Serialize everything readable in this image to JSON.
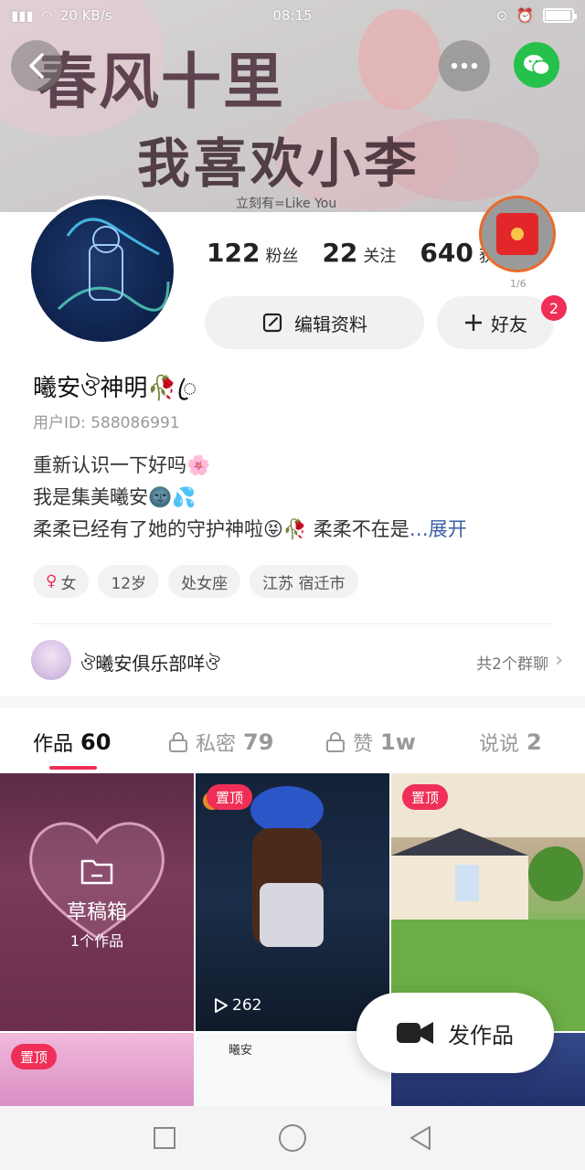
{
  "status_bar": {
    "signal_text": "2G",
    "net_speed": "20 KB/s",
    "time": "08:15"
  },
  "banner": {
    "line1": "春风十里",
    "line2": "我喜欢小李",
    "small_text": "立刻有=Like You"
  },
  "profile": {
    "stats": [
      {
        "num": "122",
        "label": "粉丝"
      },
      {
        "num": "22",
        "label": "关注"
      },
      {
        "num": "640",
        "label": "获赞"
      }
    ],
    "edit_label": "编辑资料",
    "friend_label": "好友",
    "friend_badge": "2",
    "redpack_sub": "1/6",
    "nickname": "曦安ঔ神明🥀ꦿ",
    "user_id": "用户ID: 588086991",
    "bio": [
      "重新认识一下好吗🌸",
      "我是集美曦安🌚💦",
      "柔柔已经有了她的守护神啦😝🥀 柔柔不在是"
    ],
    "bio_more": "…展开",
    "tags": [
      "女",
      "12岁",
      "处女座",
      "江苏 宿迁市"
    ]
  },
  "group": {
    "name": "ঔ曦安俱乐部咩ঔ",
    "count": "共2个群聊"
  },
  "tabs": [
    {
      "label": "作品",
      "count": "60"
    },
    {
      "label": "私密",
      "count": "79"
    },
    {
      "label": "赞",
      "count": "1w"
    },
    {
      "label": "说说",
      "count": "2"
    }
  ],
  "grid": {
    "draft_title": "草稿箱",
    "draft_sub": "1个作品",
    "pin_label": "置顶",
    "play_count": "262",
    "c5_label": "曦安"
  },
  "fab_label": "发作品",
  "colors": {
    "accent": "#ef2f57",
    "wechat": "#26c14a",
    "link": "#3b5ea6"
  }
}
